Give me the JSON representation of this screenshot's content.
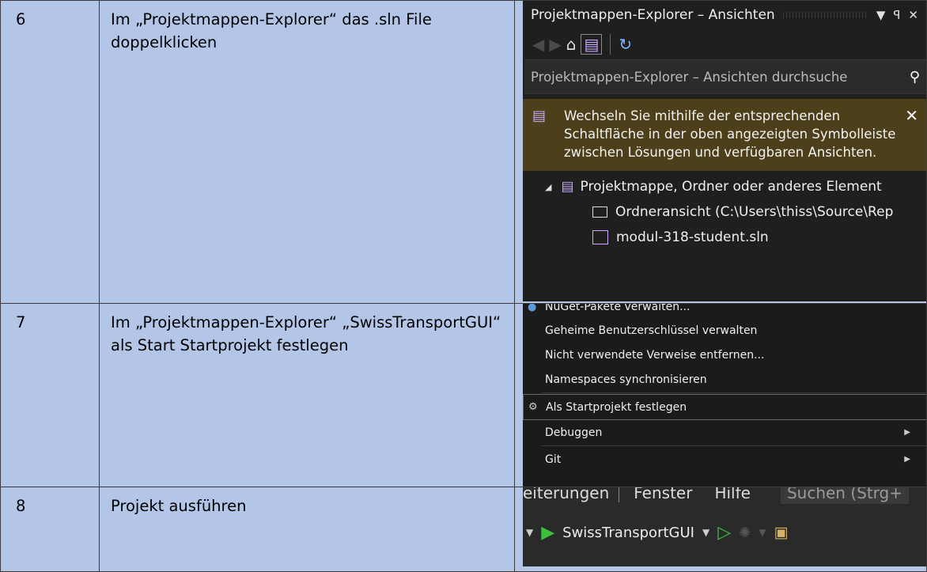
{
  "rows": [
    {
      "number": "6",
      "description": "Im „Projektmappen-Explorer“ das .sln File doppelklicken"
    },
    {
      "number": "7",
      "description": "Im „Projektmappen-Explorer“ „SwissTransportGUI“ als Start Startprojekt festlegen"
    },
    {
      "number": "8",
      "description": "Projekt ausführen"
    }
  ],
  "solution_explorer": {
    "title": "Projektmappen-Explorer – Ansichten",
    "search_placeholder": "Projektmappen-Explorer – Ansichten durchsuche",
    "info_text": "Wechseln Sie mithilfe der entsprechenden Schaltfläche in der oben angezeigten Symbolleiste zwischen Lösungen und verfügbaren Ansichten.",
    "tree": {
      "root": "Projektmappe, Ordner oder anderes Element",
      "folder_view": "Ordneransicht (C:\\Users\\thiss\\Source\\Rep",
      "solution_file": "modul-318-student.sln"
    },
    "icons": [
      "back-icon",
      "forward-icon",
      "home-icon",
      "solution-switch-icon",
      "refresh-icon",
      "search-icon",
      "close-icon",
      "pin-icon",
      "dropdown-icon"
    ]
  },
  "context_menu": {
    "items": [
      "NuGet-Pakete verwalten...",
      "Geheime Benutzerschlüssel verwalten",
      "Nicht verwendete Verweise entfernen...",
      "Namespaces synchronisieren",
      "Als Startprojekt festlegen",
      "Debuggen",
      "Git"
    ]
  },
  "toolbar": {
    "menu": [
      "eiterungen",
      "Fenster",
      "Hilfe"
    ],
    "search": "Suchen (Strg+",
    "startup_project": "SwissTransportGUI"
  },
  "colors": {
    "cell_bg": "#b4c6e7",
    "dark_bg": "#1e1e1e",
    "info_bg": "#4d3f1a",
    "run_green": "#3cc13c"
  }
}
